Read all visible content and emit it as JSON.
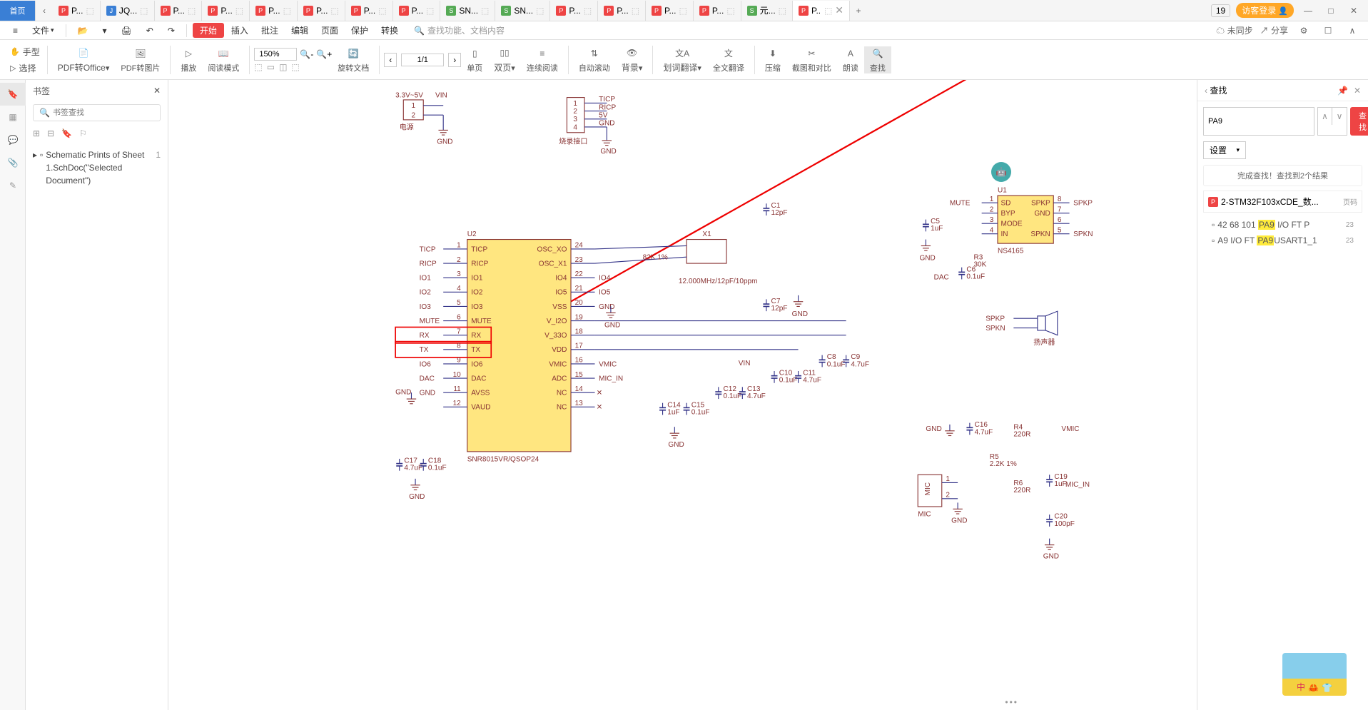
{
  "titlebar": {
    "home": "首页",
    "tabs": [
      {
        "icon": "p",
        "label": "P..."
      },
      {
        "icon": "j",
        "label": "JQ..."
      },
      {
        "icon": "p",
        "label": "P..."
      },
      {
        "icon": "p",
        "label": "P..."
      },
      {
        "icon": "p",
        "label": "P..."
      },
      {
        "icon": "p",
        "label": "P..."
      },
      {
        "icon": "p",
        "label": "P..."
      },
      {
        "icon": "p",
        "label": "P..."
      },
      {
        "icon": "s",
        "label": "SN..."
      },
      {
        "icon": "s",
        "label": "SN..."
      },
      {
        "icon": "p",
        "label": "P..."
      },
      {
        "icon": "p",
        "label": "P..."
      },
      {
        "icon": "p",
        "label": "P..."
      },
      {
        "icon": "p",
        "label": "P..."
      },
      {
        "icon": "s",
        "label": "元..."
      },
      {
        "icon": "p",
        "label": "P...",
        "active": true
      }
    ],
    "badge": "19",
    "login": "访客登录"
  },
  "menu": {
    "file": "文件",
    "items": [
      "开始",
      "插入",
      "批注",
      "编辑",
      "页面",
      "保护",
      "转换"
    ],
    "search_ph": "查找功能、文档内容",
    "right": {
      "sync": "未同步",
      "share": "分享"
    }
  },
  "toolbar": {
    "hand": "手型",
    "select": "选择",
    "pdf2office": "PDF转Office",
    "pdf2img": "PDF转图片",
    "play": "播放",
    "read": "阅读模式",
    "zoom": "150%",
    "rotate": "旋转文档",
    "page": "1/1",
    "single": "单页",
    "double": "双页",
    "continuous": "连续阅读",
    "autoscroll": "自动滚动",
    "bg": "背景",
    "trans_sel": "划词翻译",
    "trans_full": "全文翻译",
    "compress": "压缩",
    "crop": "截图和对比",
    "tts": "朗读",
    "find": "查找"
  },
  "bookmarks": {
    "title": "书签",
    "search_ph": "书签查找",
    "item": "Schematic Prints of Sheet 1.SchDoc(\"Selected Document\")",
    "page": "1"
  },
  "search": {
    "title": "查找",
    "value": "PA9",
    "btn": "查找",
    "settings": "设置",
    "status": "完成查找！查找到2个结果",
    "doc": "2-STM32F103xCDE_数...",
    "doc_page": "页码",
    "r1_pre": "42 68 101 ",
    "r1_hl": "PA9",
    "r1_post": " I/O FT P",
    "r1_pg": "23",
    "r2_pre": "A9 I/O FT ",
    "r2_hl": "PA9",
    "r2_post": "USART1_1",
    "r2_pg": "23"
  },
  "schematic": {
    "power": {
      "label": "电源",
      "v": "3.3V~5V",
      "vin": "VIN",
      "gnd": "GND",
      "pins": [
        "1",
        "2"
      ]
    },
    "prog": {
      "label": "烧录接口",
      "sigs": [
        "TICP",
        "RICP",
        "5V",
        "GND"
      ],
      "pins": [
        "1",
        "2",
        "3",
        "4"
      ]
    },
    "u2": {
      "ref": "U2",
      "part": "SNR8015VR/QSOP24",
      "left": [
        {
          "n": "TICP",
          "p": "1",
          "i": "TICP"
        },
        {
          "n": "RICP",
          "p": "2",
          "i": "RICP"
        },
        {
          "n": "IO1",
          "p": "3",
          "i": "IO1"
        },
        {
          "n": "IO2",
          "p": "4",
          "i": "IO2"
        },
        {
          "n": "IO3",
          "p": "5",
          "i": "IO3"
        },
        {
          "n": "MUTE",
          "p": "6",
          "i": "MUTE"
        },
        {
          "n": "RX",
          "p": "7",
          "i": "RX",
          "hl": true
        },
        {
          "n": "TX",
          "p": "8",
          "i": "TX",
          "hl": true
        },
        {
          "n": "IO6",
          "p": "9",
          "i": "IO6"
        },
        {
          "n": "DAC",
          "p": "10",
          "i": "DAC"
        },
        {
          "n": "GND",
          "p": "11",
          "i": "AVSS"
        },
        {
          "n": "",
          "p": "12",
          "i": "VAUD"
        }
      ],
      "right": [
        {
          "i": "OSC_XO",
          "p": "24"
        },
        {
          "i": "OSC_X1",
          "p": "23"
        },
        {
          "i": "IO4",
          "p": "22",
          "n": "IO4"
        },
        {
          "i": "IO5",
          "p": "21",
          "n": "IO5"
        },
        {
          "i": "VSS",
          "p": "20",
          "n": "GND"
        },
        {
          "i": "V_I2O",
          "p": "19"
        },
        {
          "i": "V_33O",
          "p": "18"
        },
        {
          "i": "VDD",
          "p": "17"
        },
        {
          "i": "VMIC",
          "p": "16",
          "n": "VMIC"
        },
        {
          "i": "ADC",
          "p": "15",
          "n": "MIC_IN"
        },
        {
          "i": "NC",
          "p": "14"
        },
        {
          "i": "NC",
          "p": "13"
        }
      ]
    },
    "xtal": {
      "ref": "X1",
      "val": "12.000MHz/12pF/10ppm",
      "r": "82K 1%"
    },
    "caps": {
      "c1": "12pF",
      "c7": "12pF",
      "c5": "1uF",
      "c6": "0.1uF",
      "c8": "0.1uF",
      "c9": "4.7uF",
      "c10": "0.1uF",
      "c11": "4.7uF",
      "c12": "0.1uF",
      "c13": "4.7uF",
      "c14": "1uF",
      "c15": "0.1uF",
      "c16": "4.7uF",
      "c17": "4.7uF",
      "c18": "0.1uF",
      "c19": "1uF",
      "c20": "100pF"
    },
    "res": {
      "r3": "30K",
      "r4": "220R",
      "r5": "2.2K 1%",
      "r6": "220R"
    },
    "u1": {
      "ref": "U1",
      "part": "NS4165",
      "sigs": [
        "SD",
        "BYP",
        "MODE",
        "IN",
        "SPKP",
        "GND",
        "SPKN"
      ],
      "pins": [
        "1",
        "2",
        "3",
        "4",
        "8",
        "7",
        "6",
        "5"
      ],
      "nets": [
        "MUTE",
        "SPKP",
        "SPKN",
        "DAC",
        "GND"
      ]
    },
    "spk": {
      "label": "扬声器",
      "p": "SPKP",
      "n": "SPKN"
    },
    "mic": {
      "ref": "MIC",
      "label": "MIC",
      "gnd": "GND",
      "vmic": "VMIC",
      "micin": "MIC_IN"
    }
  }
}
